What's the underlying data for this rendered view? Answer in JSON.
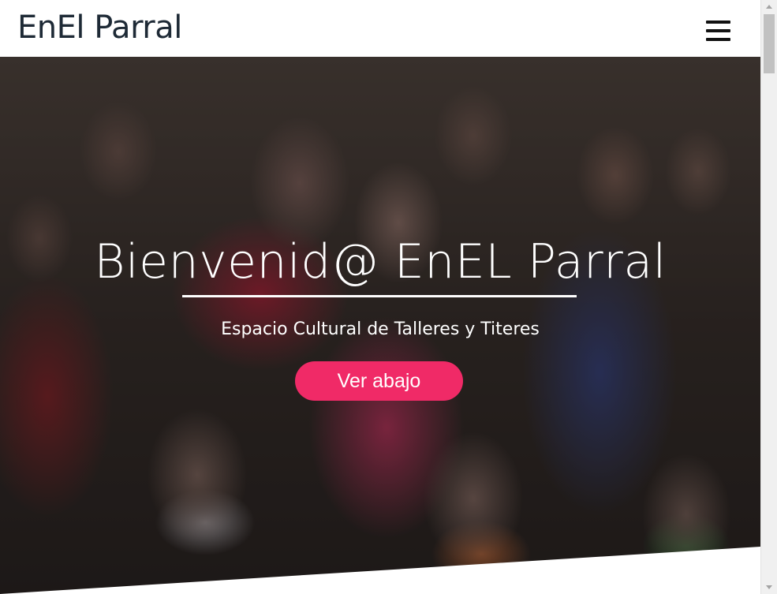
{
  "navbar": {
    "brand": "EnEl Parral",
    "menu_icon": "hamburger-menu-icon"
  },
  "hero": {
    "title": "Bienvenid@ EnEL Parral",
    "subtitle": "Espacio Cultural de Talleres y Titeres",
    "button_label": "Ver abajo",
    "background": "photo of children and families at a cultural gathering, several wearing face masks",
    "overlay_color": "#000000",
    "button_color": "#f02a67",
    "text_color": "#ffffff"
  },
  "scrollbar": {
    "up_icon": "scroll-up-arrow-icon",
    "down_icon": "scroll-down-arrow-icon"
  }
}
